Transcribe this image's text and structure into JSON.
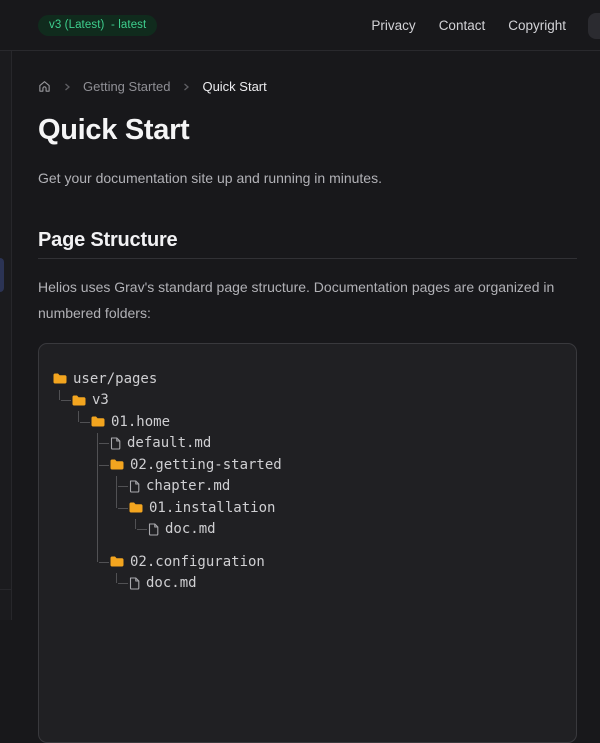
{
  "topbar": {
    "version_badge": "v3 (Latest)  - latest",
    "links": [
      {
        "label": "Privacy"
      },
      {
        "label": "Contact"
      },
      {
        "label": "Copyright"
      }
    ]
  },
  "breadcrumb": {
    "home_icon": "home-icon",
    "items": [
      {
        "label": "Getting Started"
      }
    ],
    "current": "Quick Start"
  },
  "page": {
    "title": "Quick Start",
    "intro": "Get your documentation site up and running in minutes.",
    "section": {
      "heading": "Page Structure",
      "body": "Helios uses Grav's standard page structure. Documentation pages are organized in numbered folders:"
    }
  },
  "file_tree": {
    "rows": [
      {
        "depth": 0,
        "connector": "",
        "icon": "folder",
        "name": "user/pages"
      },
      {
        "depth": 1,
        "connector": "└",
        "icon": "folder",
        "name": "v3"
      },
      {
        "depth": 2,
        "connector": " └",
        "icon": "folder",
        "name": "01.home"
      },
      {
        "depth": 3,
        "connector": "  ├",
        "icon": "file",
        "name": "default.md"
      },
      {
        "depth": 3,
        "connector": "  ├",
        "icon": "folder",
        "name": "02.getting-started"
      },
      {
        "depth": 4,
        "connector": "  │├",
        "icon": "file",
        "name": "chapter.md"
      },
      {
        "depth": 4,
        "connector": "  │└",
        "icon": "folder",
        "name": "01.installation"
      },
      {
        "depth": 5,
        "connector": "  │ └",
        "icon": "file",
        "name": "doc.md"
      },
      {
        "blank": true,
        "connector": "  │"
      },
      {
        "depth": 3,
        "connector": "  └",
        "icon": "folder",
        "name": "02.configuration"
      },
      {
        "depth": 4,
        "connector": "   └",
        "icon": "file",
        "name": "doc.md"
      }
    ]
  },
  "colors": {
    "accent_green": "#3ecf8e",
    "badge_bg": "#102b1d",
    "folder_icon": "#f3a51f",
    "file_icon": "#a9a9ad",
    "tree_line": "#515154",
    "active_marker_blue": "#2b3354",
    "page_bg": "#18181b",
    "code_bg": "#202023"
  }
}
